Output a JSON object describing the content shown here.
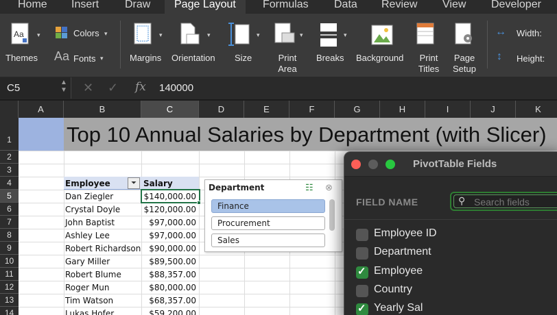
{
  "ribbon_tabs": [
    "Home",
    "Insert",
    "Draw",
    "Page Layout",
    "Formulas",
    "Data",
    "Review",
    "View",
    "Developer"
  ],
  "ribbon": {
    "themes": "Themes",
    "colors": "Colors",
    "fonts": "Fonts",
    "margins": "Margins",
    "orientation": "Orientation",
    "size": "Size",
    "print_area": "Print Area",
    "breaks": "Breaks",
    "background": "Background",
    "print_titles": "Print Titles",
    "page_setup": "Page Setup",
    "width": "Width:",
    "height": "Height:"
  },
  "formula_bar": {
    "cell_ref": "C5",
    "value": "140000"
  },
  "columns": [
    "A",
    "B",
    "C",
    "D",
    "E",
    "F",
    "G",
    "H",
    "I",
    "J",
    "K"
  ],
  "rows": [
    "1",
    "2",
    "3",
    "4",
    "5",
    "6",
    "7",
    "8",
    "9",
    "10",
    "11",
    "12",
    "13",
    "14"
  ],
  "sheet": {
    "title": "Top 10 Annual Salaries by Department (with Slicer)",
    "header_employee": "Employee",
    "header_salary": "Salary",
    "data": [
      {
        "employee": "Dan Ziegler",
        "salary": "$140,000.00"
      },
      {
        "employee": "Crystal Doyle",
        "salary": "$120,000.00"
      },
      {
        "employee": "John Baptist",
        "salary": "$97,000.00"
      },
      {
        "employee": "Ashley Lee",
        "salary": "$97,000.00"
      },
      {
        "employee": "Robert Richardson",
        "salary": "$90,000.00"
      },
      {
        "employee": "Gary Miller",
        "salary": "$89,500.00"
      },
      {
        "employee": "Robert Blume",
        "salary": "$88,357.00"
      },
      {
        "employee": "Roger Mun",
        "salary": "$80,000.00"
      },
      {
        "employee": "Tim Watson",
        "salary": "$68,357.00"
      },
      {
        "employee": "Lukas Hofer",
        "salary": "$59,200.00"
      }
    ]
  },
  "slicer": {
    "title": "Department",
    "items": [
      "Finance",
      "Procurement",
      "Sales"
    ],
    "selected": "Finance"
  },
  "pivot_pane": {
    "title": "PivotTable Fields",
    "field_name_label": "FIELD NAME",
    "search_placeholder": "Search fields",
    "fields": [
      {
        "label": "Employee ID",
        "checked": false
      },
      {
        "label": "Department",
        "checked": false
      },
      {
        "label": "Employee",
        "checked": true
      },
      {
        "label": "Country",
        "checked": false
      },
      {
        "label": "Yearly Sal",
        "checked": true
      }
    ]
  },
  "colors": {
    "accent_green": "#2f8a3f",
    "slicer_selected": "#a9c3e8",
    "title_fill": "#a6a6a6"
  }
}
